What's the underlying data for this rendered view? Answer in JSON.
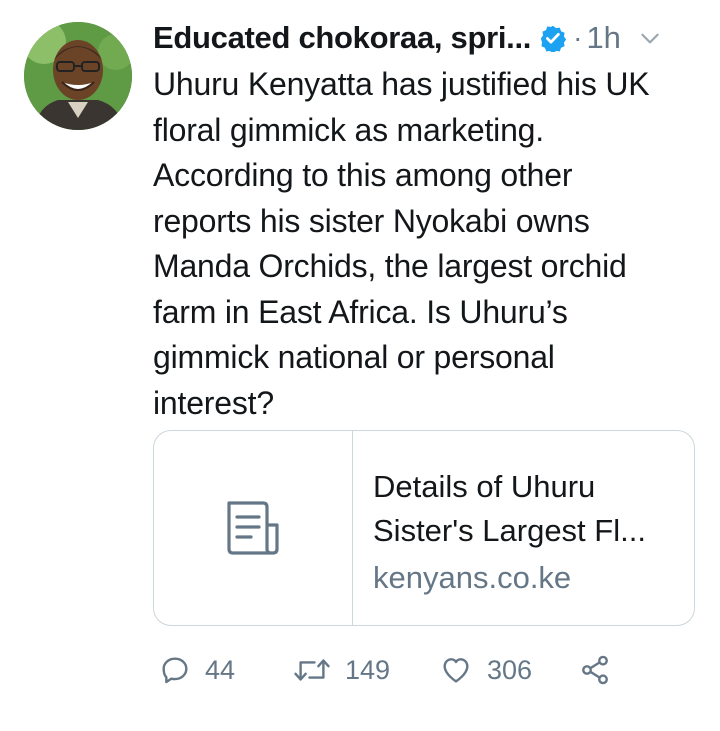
{
  "tweet": {
    "display_name": "Educated chokoraa, spri...",
    "separator": "·",
    "time": "1h",
    "text_lines": [
      "Uhuru Kenyatta has justified his UK",
      "floral gimmick as marketing.",
      "According to this among other",
      "reports his sister Nyokabi owns",
      "Manda Orchids, the largest orchid",
      "farm in East Africa. Is Uhuru’s",
      "gimmick national or personal",
      "interest?"
    ]
  },
  "card": {
    "title_line1": "Details of Uhuru",
    "title_line2": "Sister's Largest Fl...",
    "domain": "kenyans.co.ke",
    "icon": "article-icon"
  },
  "actions": {
    "reply_count": "44",
    "retweet_count": "149",
    "like_count": "306",
    "reply_icon": "reply-icon",
    "retweet_icon": "retweet-icon",
    "like_icon": "heart-icon",
    "share_icon": "share-icon"
  },
  "colors": {
    "text": "#14171a",
    "secondary": "#657786",
    "verified": "#1da1f2",
    "border": "#ccd6dd"
  }
}
